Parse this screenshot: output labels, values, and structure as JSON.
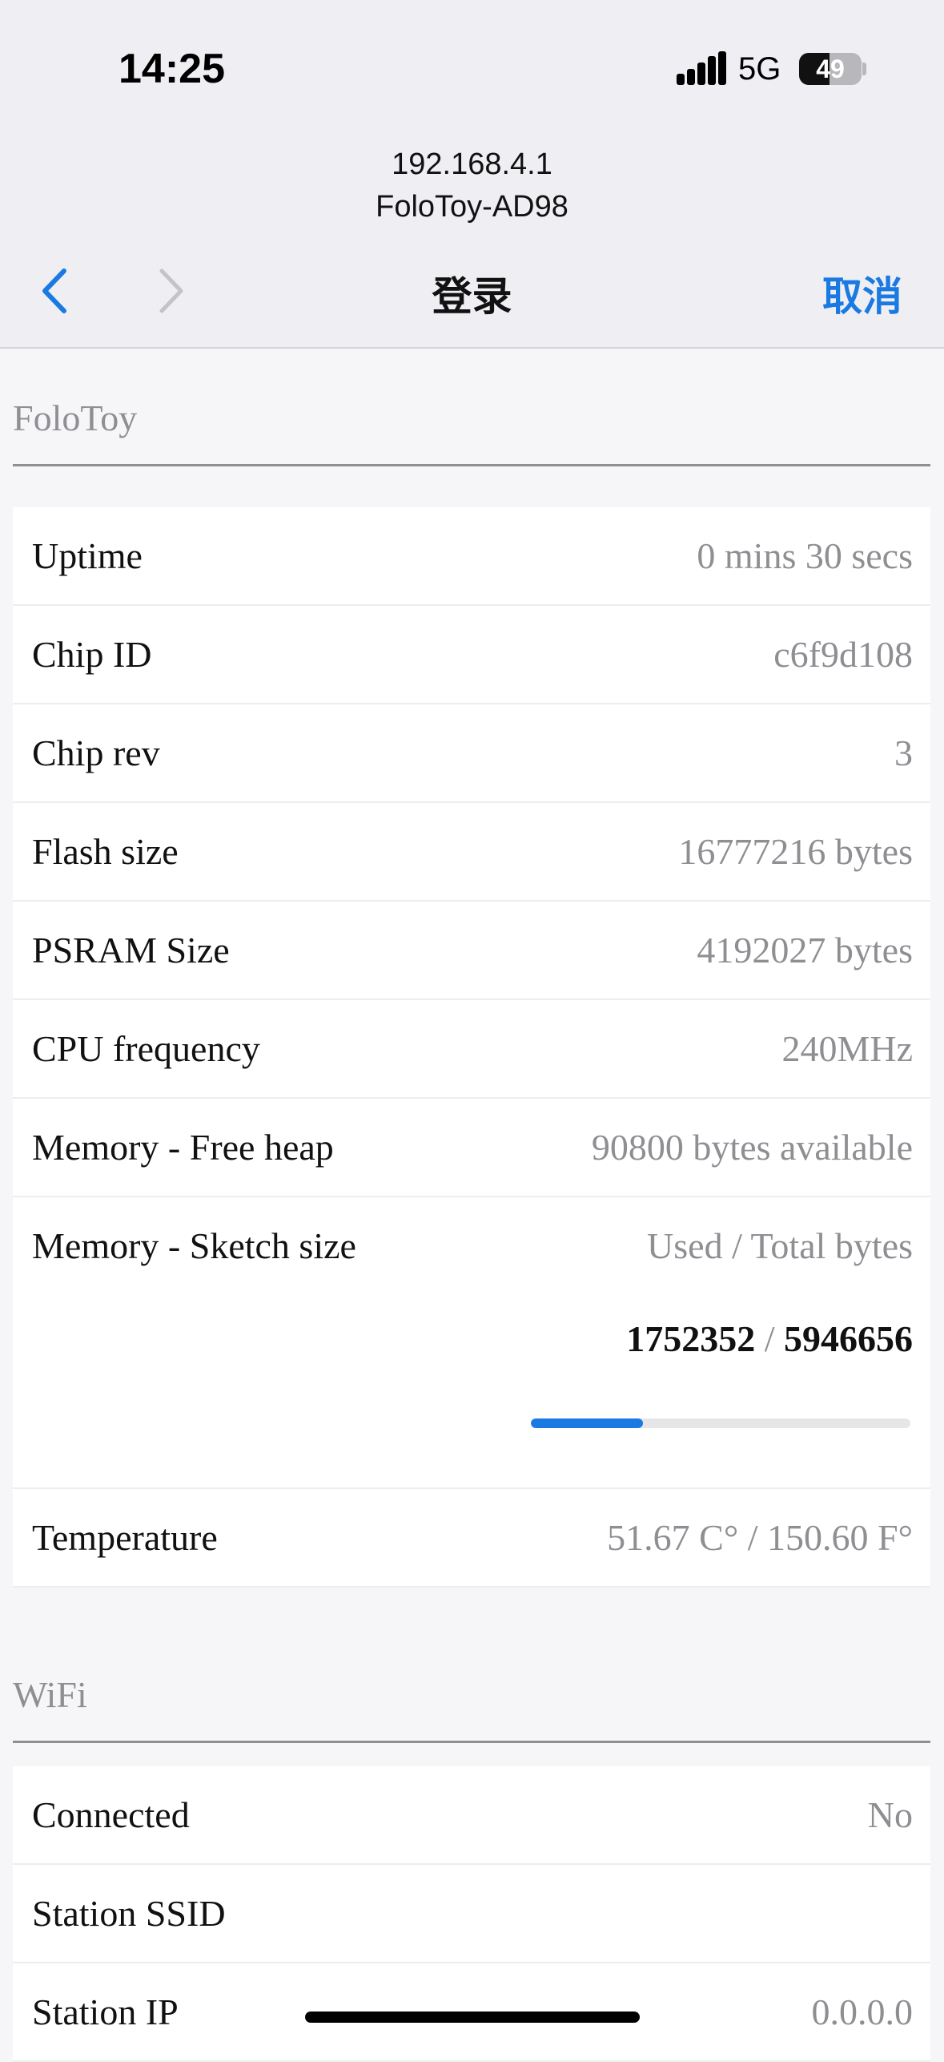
{
  "status_bar": {
    "time": "14:25",
    "network": "5G",
    "battery_percent": "49",
    "battery_level": 0.49
  },
  "browser": {
    "address": "192.168.4.1",
    "site_name": "FoloToy-AD98",
    "page_title": "登录",
    "cancel_label": "取消"
  },
  "folotoy": {
    "title": "FoloToy",
    "rows": [
      {
        "label": "Uptime",
        "value": "0 mins 30 secs"
      },
      {
        "label": "Chip ID",
        "value": "c6f9d108"
      },
      {
        "label": "Chip rev",
        "value": "3"
      },
      {
        "label": "Flash size",
        "value": "16777216 bytes"
      },
      {
        "label": "PSRAM Size",
        "value": "4192027 bytes"
      },
      {
        "label": "CPU frequency",
        "value": "240MHz"
      },
      {
        "label": "Memory - Free heap",
        "value": "90800 bytes available"
      }
    ],
    "sketch": {
      "label": "Memory - Sketch size",
      "header": "Used / Total bytes",
      "used": "1752352",
      "separator": "/",
      "total": "5946656",
      "used_fraction": 0.2947
    },
    "temperature": {
      "label": "Temperature",
      "value": "51.67 C° / 150.60 F°"
    }
  },
  "wifi": {
    "title": "WiFi",
    "rows": [
      {
        "label": "Connected",
        "value": "No"
      },
      {
        "label": "Station SSID",
        "value": ""
      },
      {
        "label": "Station IP",
        "value": "0.0.0.0"
      }
    ]
  }
}
